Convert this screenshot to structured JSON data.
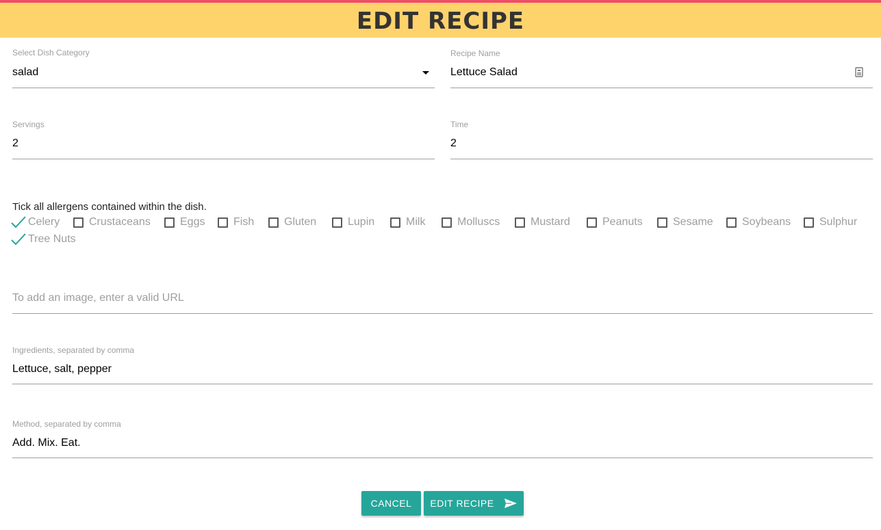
{
  "header": {
    "title": "EDIT RECIPE"
  },
  "form": {
    "category": {
      "label": "Select Dish Category",
      "value": "salad"
    },
    "recipe_name": {
      "label": "Recipe Name",
      "value": "Lettuce Salad"
    },
    "servings": {
      "label": "Servings",
      "value": "2"
    },
    "time": {
      "label": "Time",
      "value": "2"
    },
    "allergens": {
      "title": "Tick all allergens contained within the dish.",
      "items": [
        {
          "label": "Celery",
          "checked": true
        },
        {
          "label": "Crustaceans",
          "checked": false
        },
        {
          "label": "Eggs",
          "checked": false
        },
        {
          "label": "Fish",
          "checked": false
        },
        {
          "label": "Gluten",
          "checked": false
        },
        {
          "label": "Lupin",
          "checked": false
        },
        {
          "label": "Milk",
          "checked": false
        },
        {
          "label": "Molluscs",
          "checked": false
        },
        {
          "label": "Mustard",
          "checked": false
        },
        {
          "label": "Peanuts",
          "checked": false
        },
        {
          "label": "Sesame",
          "checked": false
        },
        {
          "label": "Soybeans",
          "checked": false
        },
        {
          "label": "Sulphur",
          "checked": false
        },
        {
          "label": "Tree Nuts",
          "checked": true
        }
      ]
    },
    "image_url": {
      "placeholder": "To add an image, enter a valid URL",
      "value": ""
    },
    "ingredients": {
      "label": "Ingredients, separated by comma",
      "value": "Lettuce, salt, pepper"
    },
    "method": {
      "label": "Method, separated by comma",
      "value": "Add. Mix. Eat."
    }
  },
  "actions": {
    "cancel_label": "CANCEL",
    "submit_label": "EDIT RECIPE"
  },
  "colors": {
    "accent": "#26a69a",
    "header_bg": "#ffd36b",
    "top_strip": "#ef4e6a"
  },
  "icons": {
    "select": "caret-down-icon",
    "name_field": "clipboard-icon",
    "submit": "send-icon",
    "checked": "checkmark-icon"
  }
}
